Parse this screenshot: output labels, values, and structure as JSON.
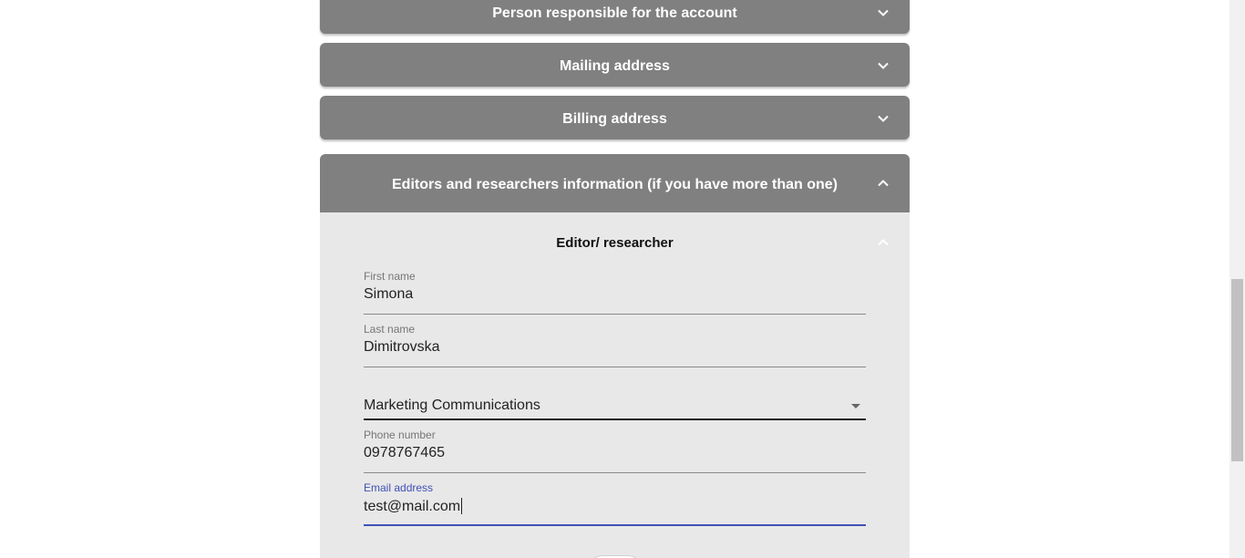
{
  "panels": {
    "person_responsible": {
      "title": "Person responsible for the account",
      "state": "collapsed"
    },
    "mailing_address": {
      "title": "Mailing address",
      "state": "collapsed"
    },
    "billing_address": {
      "title": "Billing address",
      "state": "collapsed"
    },
    "editors_researchers": {
      "title": "Editors and researchers information (if you have more than one)",
      "state": "expanded"
    }
  },
  "editor_section": {
    "title": "Editor/ researcher",
    "fields": {
      "first_name": {
        "label": "First name",
        "value": "Simona"
      },
      "last_name": {
        "label": "Last name",
        "value": "Dimitrovska"
      },
      "department": {
        "value": "Marketing Communications"
      },
      "phone": {
        "label": "Phone number",
        "value": "0978767465"
      },
      "email": {
        "label": "Email address",
        "value": "test@mail.com"
      }
    }
  },
  "icons": {
    "collapsed": "chevron-down-icon",
    "expanded": "chevron-up-icon",
    "dropdown": "caret-down-icon"
  },
  "colors": {
    "header_bg": "#808080",
    "body_bg": "#e8e8e8",
    "focus_accent": "#3f51b5"
  }
}
